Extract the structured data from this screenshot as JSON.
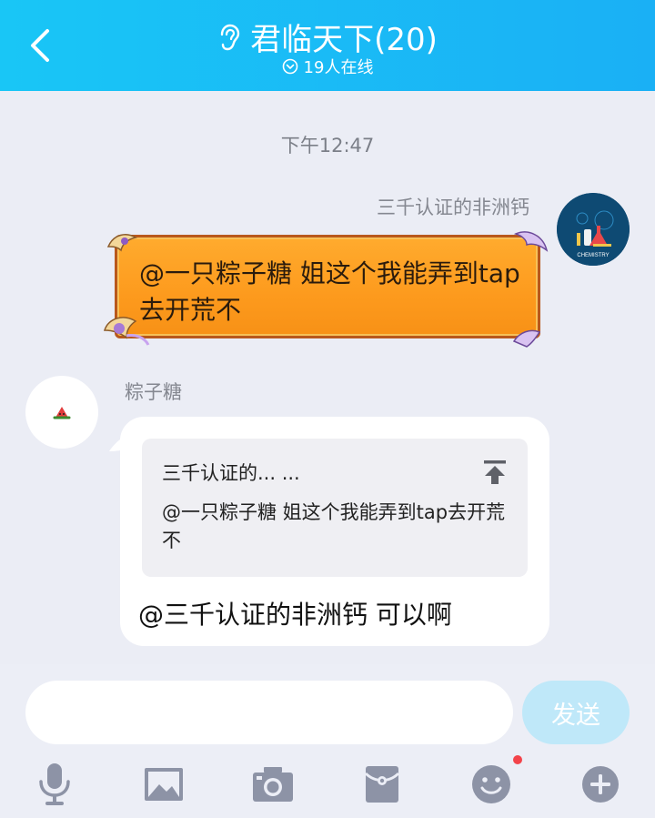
{
  "header": {
    "title": "君临天下(20)",
    "online_status": "19人在线"
  },
  "chat": {
    "timestamp": "下午12:47",
    "messages": [
      {
        "sender": "三千认证的非洲钙",
        "avatar_text": "CHEMISTRY",
        "text": "@一只粽子糖 姐这个我能弄到tap去开荒不"
      },
      {
        "sender": "粽子糖",
        "quote_title": "三千认证的... ...",
        "quote_text": "@一只粽子糖 姐这个我能弄到tap去开荒不",
        "text": "@三千认证的非洲钙 可以啊"
      }
    ]
  },
  "composer": {
    "input_value": "",
    "send_label": "发送"
  },
  "toolbar": {
    "icons": [
      "microphone-icon",
      "image-icon",
      "camera-icon",
      "red-packet-icon",
      "emoji-icon",
      "plus-icon"
    ],
    "notification_dot_color": "#f3434a"
  },
  "colors": {
    "header_start": "#19c6f6",
    "header_end": "#1ab0f5",
    "send_button": "#bfe8f9",
    "icon_gray": "#8d93a6"
  }
}
